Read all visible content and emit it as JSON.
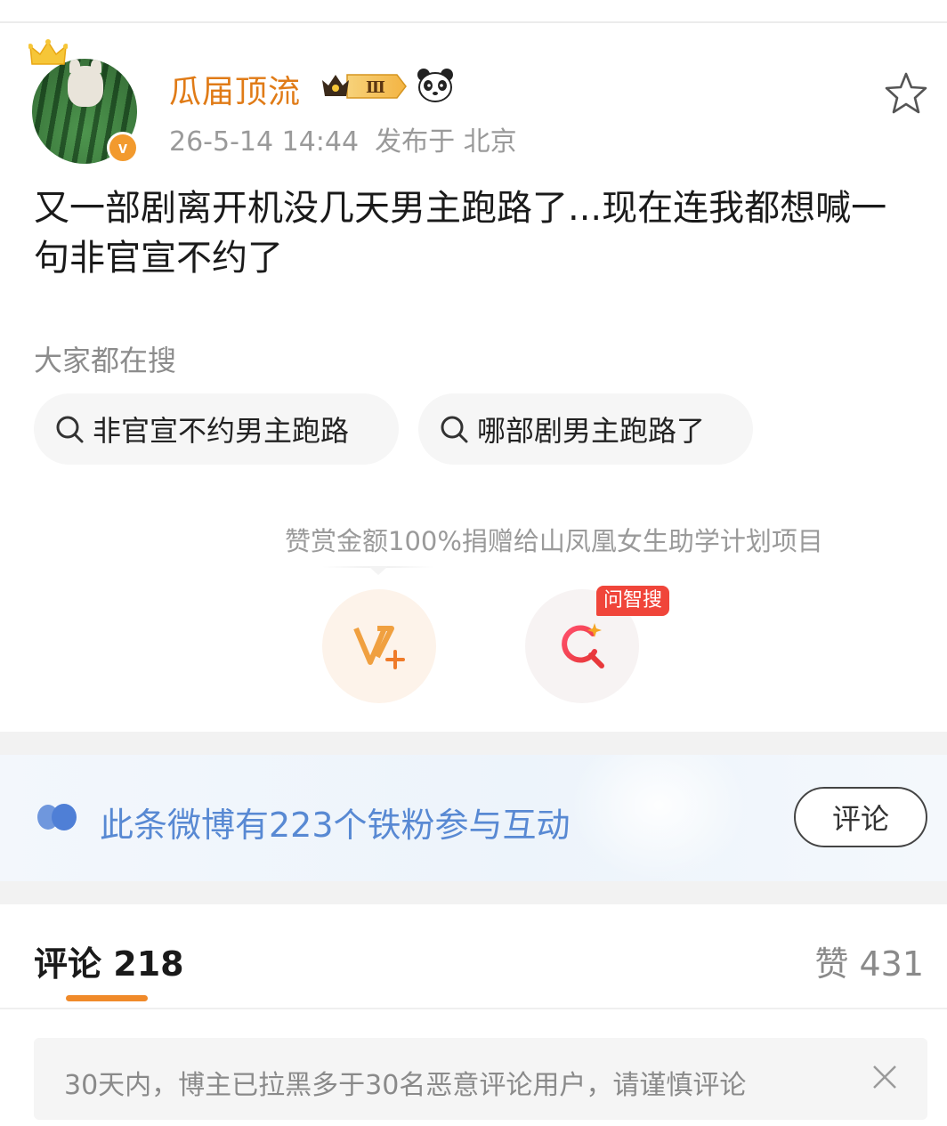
{
  "post": {
    "username": "瓜届顶流",
    "badge_level": "Ⅲ",
    "date": "26-5-14 14:44",
    "location": "发布于 北京",
    "verify_mark": "v",
    "content": "又一部剧离开机没几天男主跑路了...现在连我都想喊一句非官宣不约了"
  },
  "search": {
    "title": "大家都在搜",
    "chips": [
      "非官宣不约男主跑路",
      "哪部剧男主跑路了"
    ]
  },
  "actions": {
    "donate_text": "赞赏金额100%捐赠给山凤凰女生助学计划项目",
    "ask_tag": "问智搜"
  },
  "fans": {
    "text": "此条微博有223个铁粉参与互动",
    "button": "评论"
  },
  "tabs": {
    "comments_label": "评论",
    "comments_count": "218",
    "likes_label": "赞",
    "likes_count": "431"
  },
  "notice": {
    "text": "30天内，博主已拉黑多于30名恶意评论用户，请谨慎评论"
  },
  "colors": {
    "username": "#e07b17",
    "accent_orange": "#f08a2a",
    "fans_blue": "#5889d3",
    "tag_red": "#f0453a"
  },
  "icons": [
    "crown-icon",
    "verified-icon",
    "level-badge-icon",
    "panda-icon",
    "favorite-star-icon",
    "search-icon",
    "reward-v-plus-icon",
    "ask-search-icon",
    "fans-icon",
    "close-icon"
  ]
}
